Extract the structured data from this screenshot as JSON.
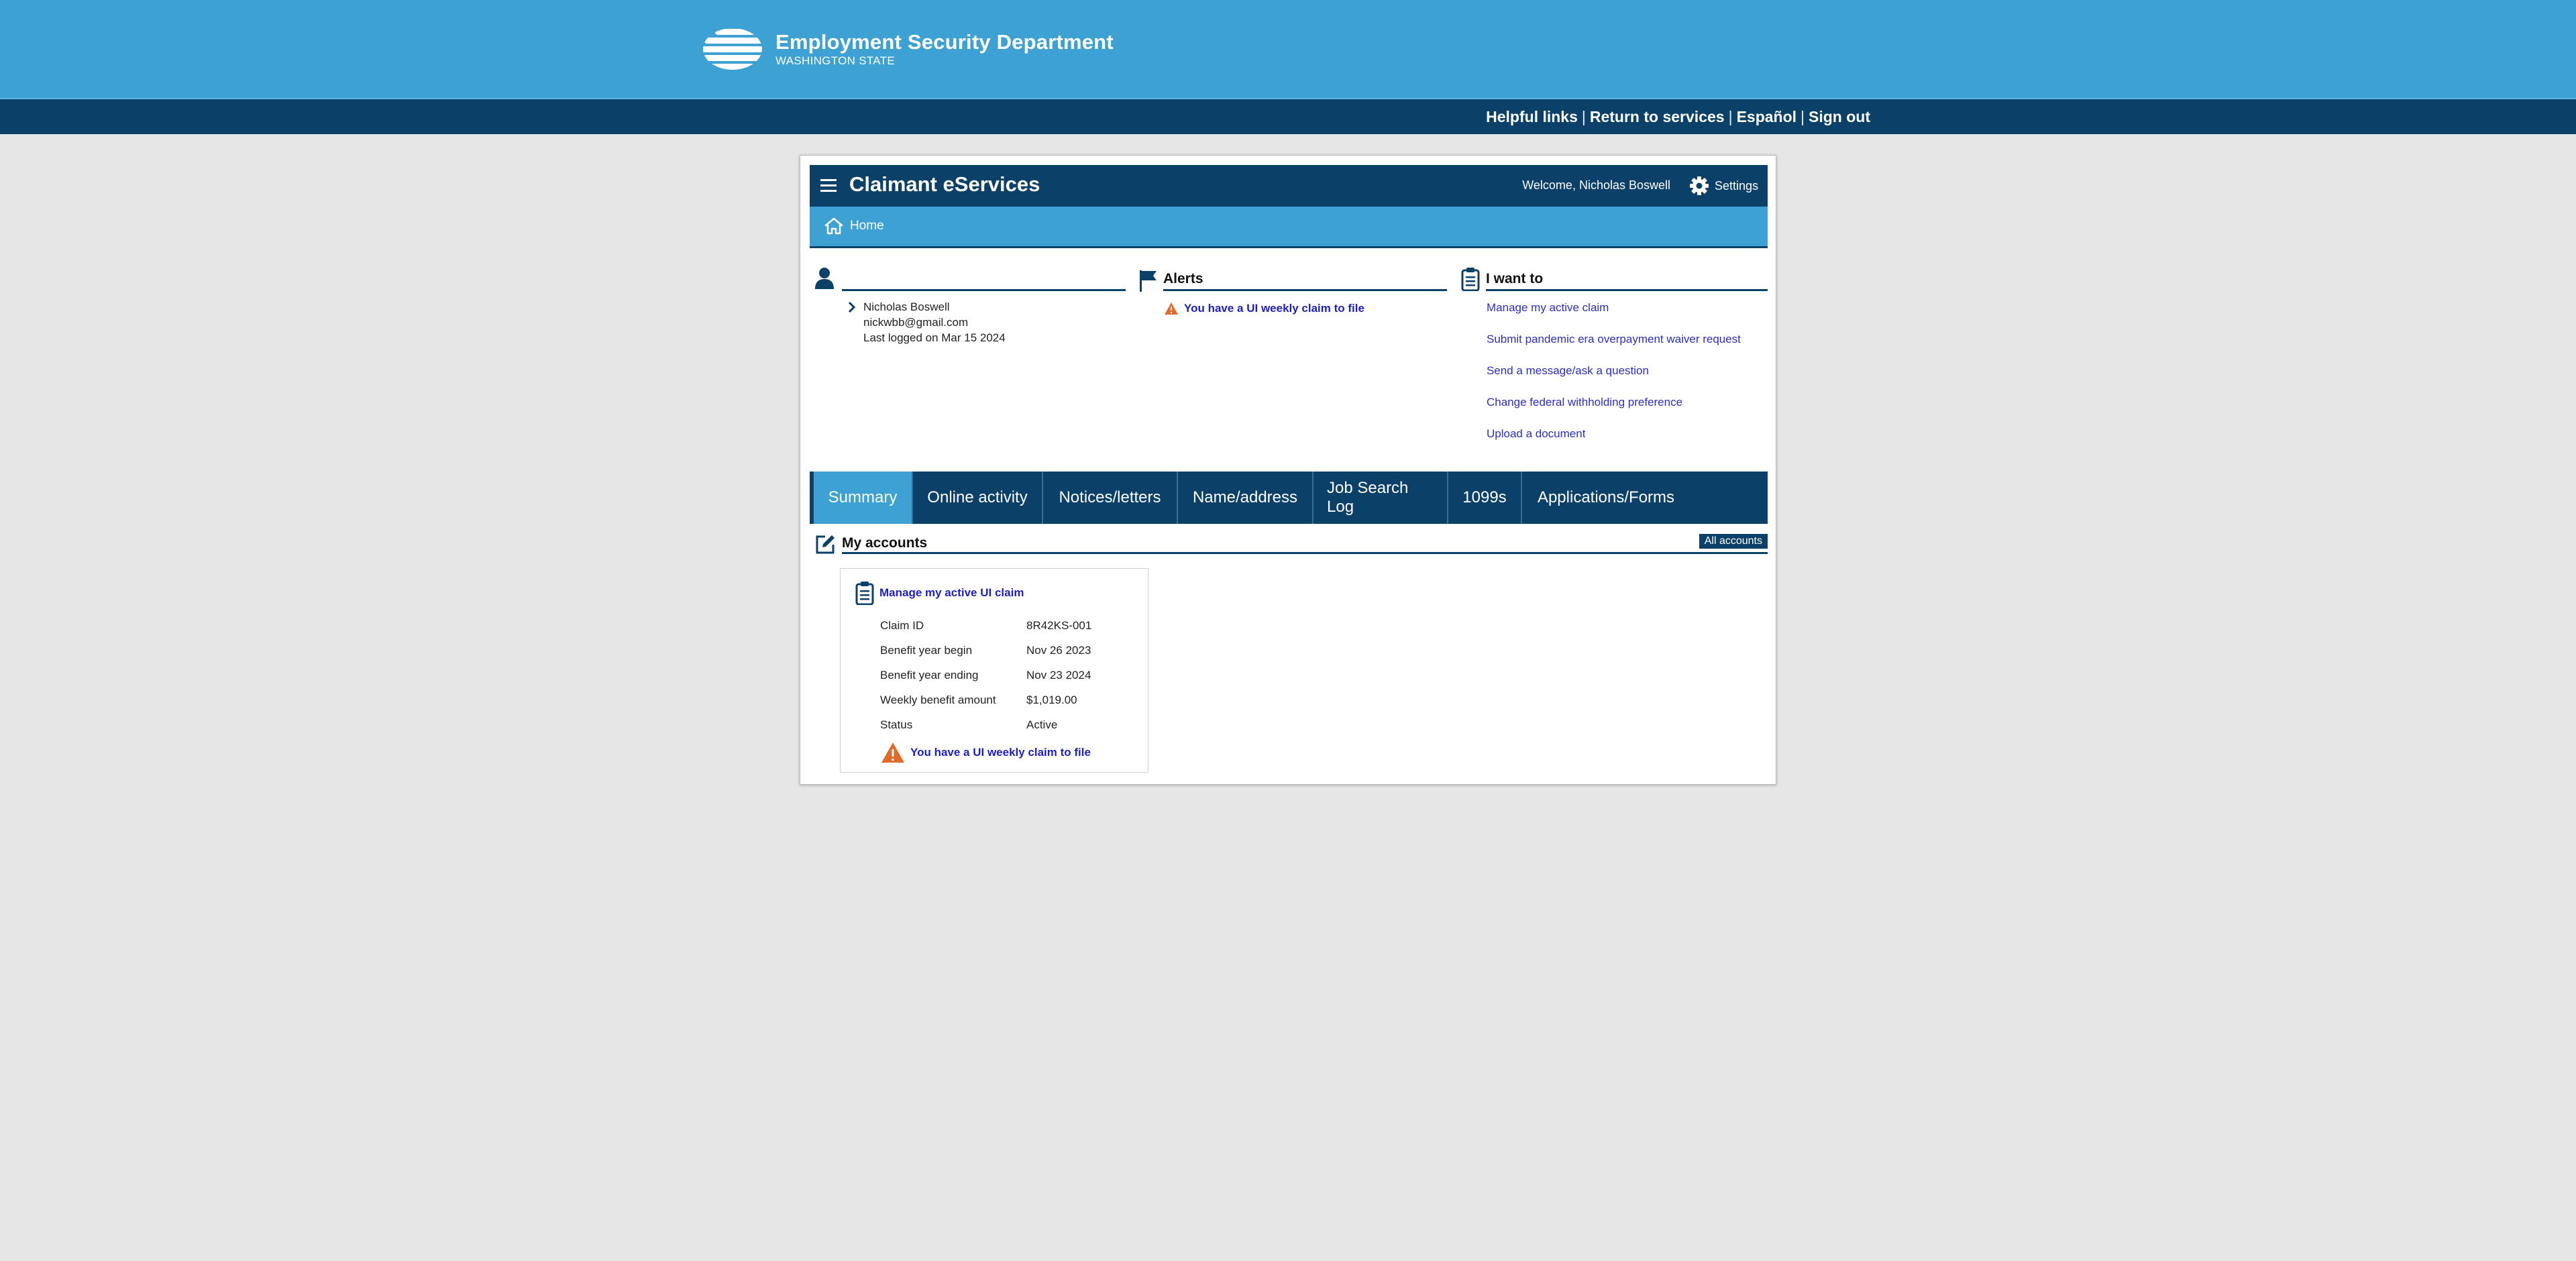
{
  "header": {
    "org_name": "Employment Security Department",
    "org_sub": "WASHINGTON STATE"
  },
  "utility_nav": [
    "Helpful links",
    "Return to services",
    "Español",
    "Sign out"
  ],
  "app": {
    "title": "Claimant eServices",
    "welcome": "Welcome, Nicholas Boswell",
    "settings_label": "Settings",
    "breadcrumb_home": "Home"
  },
  "user": {
    "name": "Nicholas Boswell",
    "email": "nickwbb@gmail.com",
    "last_login": "Last logged on Mar 15 2024"
  },
  "alerts": {
    "heading": "Alerts",
    "items": [
      "You have a UI weekly claim to file"
    ]
  },
  "i_want_to": {
    "heading": "I want to",
    "links": [
      "Manage my active claim",
      "Submit pandemic era overpayment waiver request",
      "Send a message/ask a question",
      "Change federal withholding preference",
      "Upload a document"
    ]
  },
  "tabs": [
    "Summary",
    "Online activity",
    "Notices/letters",
    "Name/address",
    "Job Search Log",
    "1099s",
    "Applications/Forms"
  ],
  "accounts": {
    "heading": "My accounts",
    "all_accounts": "All accounts",
    "card": {
      "title": "Manage my active UI claim",
      "rows": [
        {
          "label": "Claim ID",
          "value": "8R42KS-001"
        },
        {
          "label": "Benefit year begin",
          "value": "Nov 26 2023"
        },
        {
          "label": "Benefit year ending",
          "value": "Nov 23 2024"
        },
        {
          "label": "Weekly benefit amount",
          "value": "$1,019.00"
        },
        {
          "label": "Status",
          "value": "Active"
        }
      ],
      "alert": "You have a UI weekly claim to file"
    }
  },
  "colors": {
    "banner": "#3da1d3",
    "navy": "#0b4168",
    "link": "#1f1fbf",
    "warning": "#e26a2c"
  }
}
